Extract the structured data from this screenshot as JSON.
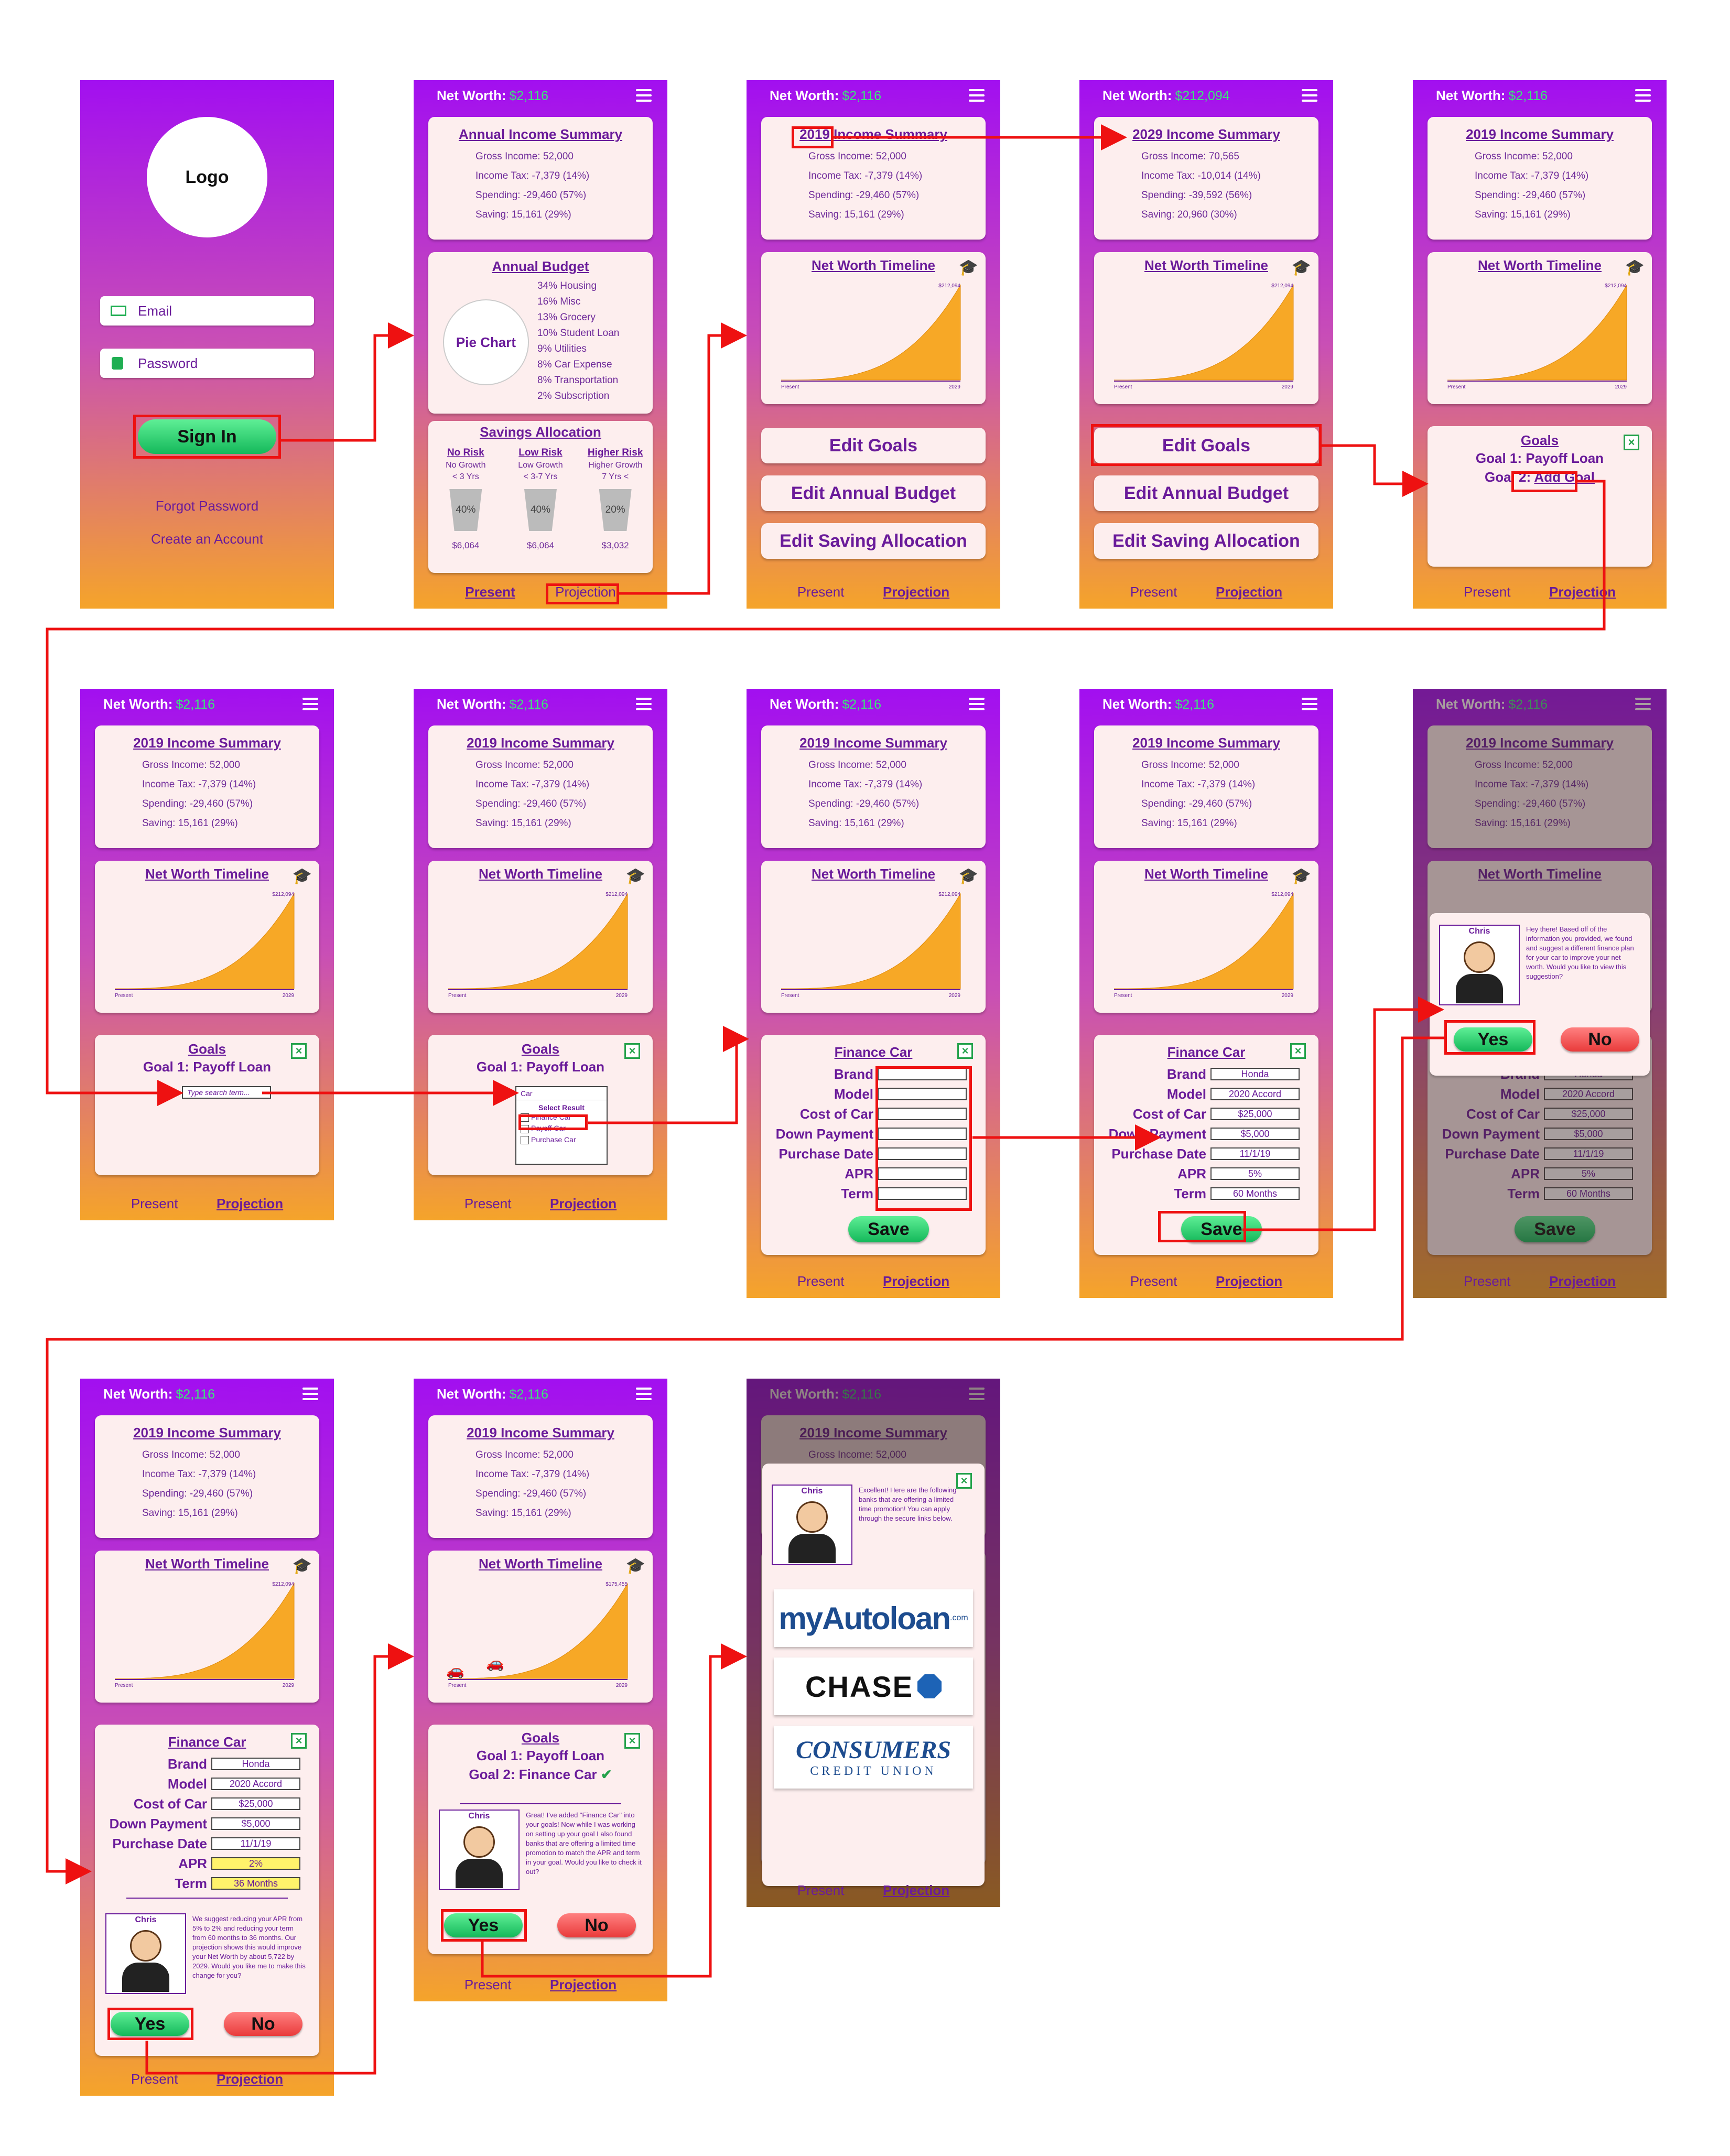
{
  "colors": {
    "accent": "#a20ff0",
    "highlight": "#ee1111",
    "networth": "#3ce67a",
    "chart_fill": "#f7a826",
    "yes": "#22c466",
    "no": "#f05252"
  },
  "common": {
    "net_worth_label": "Net Worth:",
    "net_worth_value": "$2,116",
    "net_worth_value_2029": "$212,094",
    "tab_present": "Present",
    "tab_projection": "Projection",
    "income_title_annual": "Annual Income Summary",
    "income_title_2019": "2019 Income Summary",
    "income_title_2029": "2029 Income Summary",
    "income_2019": [
      "Gross Income: 52,000",
      "Income Tax: -7,379 (14%)",
      "Spending: -29,460 (57%)",
      "Saving: 15,161 (29%)"
    ],
    "income_2029": [
      "Gross Income: 70,565",
      "Income Tax: -10,014 (14%)",
      "Spending: -39,592 (56%)",
      "Saving: 20,960 (30%)"
    ],
    "timeline_title": "Net Worth Timeline",
    "timeline_present": "Present",
    "timeline_end": "2029",
    "timeline_top": "$212,094",
    "timeline_top_alt": "$175,455",
    "graduation_icon": "graduation-cap-icon"
  },
  "login": {
    "logo": "Logo",
    "email_placeholder": "Email",
    "password_placeholder": "Password",
    "sign_in": "Sign In",
    "forgot": "Forgot Password",
    "create": "Create an Account"
  },
  "budget": {
    "title": "Annual Budget",
    "pie_label": "Pie Chart",
    "items": [
      "34% Housing",
      "16% Misc",
      "13% Grocery",
      "10% Student Loan",
      "9% Utilities",
      "8% Car Expense",
      "8% Transportation",
      "2% Subscription"
    ]
  },
  "savings": {
    "title": "Savings Allocation",
    "columns": [
      {
        "name": "No Risk",
        "desc1": "No Growth",
        "desc2": "< 3 Yrs",
        "pct": "40%",
        "amount": "$6,064"
      },
      {
        "name": "Low Risk",
        "desc1": "Low Growth",
        "desc2": "< 3-7 Yrs",
        "pct": "40%",
        "amount": "$6,064"
      },
      {
        "name": "Higher Risk",
        "desc1": "Higher Growth",
        "desc2": "7 Yrs <",
        "pct": "20%",
        "amount": "$3,032"
      }
    ]
  },
  "edit_buttons": {
    "goals": "Edit Goals",
    "budget": "Edit Annual Budget",
    "saving": "Edit Saving Allocation"
  },
  "goals": {
    "title": "Goals",
    "goal1": "Goal 1: Payoff Loan",
    "goal2_prefix": "Goal 2:",
    "add_goal": "Add Goal",
    "goal2_done": "Goal 2: Finance Car",
    "search_placeholder": "Type search term...",
    "search_value": "Car",
    "select_result": "Select Result",
    "results": [
      "Finance Car",
      "Payoff Car",
      "Purchase Car"
    ]
  },
  "finance": {
    "title": "Finance Car",
    "labels": [
      "Brand",
      "Model",
      "Cost of Car",
      "Down Payment",
      "Purchase Date",
      "APR",
      "Term"
    ],
    "values": [
      "Honda",
      "2020 Accord",
      "$25,000",
      "$5,000",
      "11/1/19",
      "5%",
      "60 Months"
    ],
    "values_suggested": [
      "Honda",
      "2020 Accord",
      "$25,000",
      "$5,000",
      "11/1/19",
      "2%",
      "36 Months"
    ],
    "save": "Save"
  },
  "chris": {
    "name": "Chris",
    "msg1": "Hey there! Based off of the information you provided, we found and suggest a different finance plan for your car to improve your net worth. Would you like to view this suggestion?",
    "msg2": "We suggest reducing your APR from 5% to 2% and reducing your term from 60 months to 36 months. Our projection shows this would improve your Net Worth by about 5,722 by 2029. Would you like me to make this change for you?",
    "msg3": "Great! I've added \"Finance Car\" into your goals! Now while I was working on setting up your goal I also found banks that are offering a limited time promotion to match the APR and term in your goal. Would you like to check it out?",
    "msg4": "Excellent! Here are the following banks that are offering a limited time promotion! You can apply through the secure links below.",
    "yes": "Yes",
    "no": "No"
  },
  "banks": [
    "myAutoloan",
    ".com",
    "CHASE",
    "CONSUMERS",
    "CREDIT UNION"
  ]
}
